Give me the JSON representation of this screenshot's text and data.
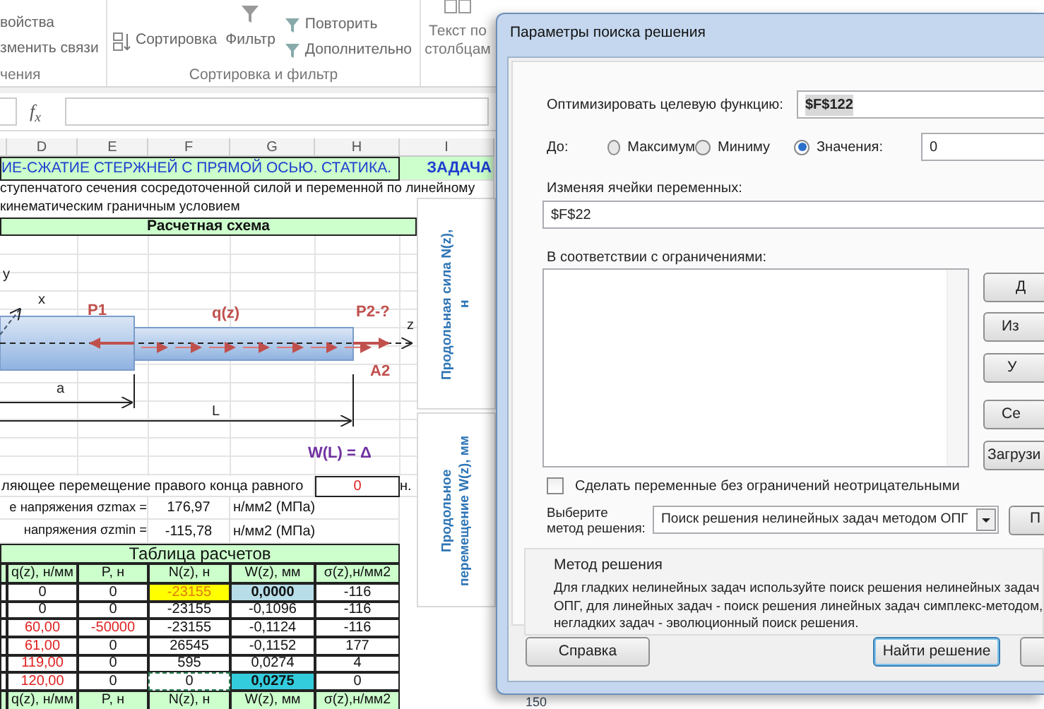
{
  "ribbon": {
    "connections": {
      "items": [
        "войства",
        "зменить связи"
      ],
      "label": "чения"
    },
    "sort_filter": {
      "sort": "Сортировка",
      "filter": "Фильтр",
      "items": [
        "Повторить",
        "Дополнительно"
      ],
      "label": "Сортировка и фильтр"
    },
    "text_to_columns": [
      "Текст по",
      "столбцам"
    ]
  },
  "formula_bar": {
    "fx": "f$_{x}$"
  },
  "columns": [
    "D",
    "E",
    "F",
    "G",
    "H",
    "I"
  ],
  "sheet": {
    "title": "ИЕ-СЖАТИЕ СТЕРЖНЕЙ С ПРЯМОЙ ОСЬЮ. СТАТИКА.",
    "task": "ЗАДАЧА",
    "description": [
      "ступенчатого сечения сосредоточенной силой и переменной по линейному",
      "кинематическим граничным условием"
    ],
    "scheme_title": "Расчетная схема",
    "scheme_labels": [
      {
        "text": "y",
        "kind": "axis"
      },
      {
        "text": "x",
        "kind": "axis"
      },
      {
        "text": "P1",
        "kind": "force"
      },
      {
        "text": "q(z)",
        "kind": "force"
      },
      {
        "text": "P2-?",
        "kind": "force"
      },
      {
        "text": "z",
        "kind": "axis"
      },
      {
        "text": "A2",
        "kind": "force"
      },
      {
        "text": "a",
        "kind": "dimension"
      },
      {
        "text": "L",
        "kind": "dimension"
      },
      {
        "text": "W(L) = Δ",
        "kind": "displacement"
      }
    ],
    "side_charts": [
      {
        "title": "Продольная сила N(z), н"
      },
      {
        "title": "Продольное перемещение W(z), мм"
      }
    ],
    "results": [
      {
        "kind": "target",
        "label": "ляющее перемещение правого конца равного",
        "value": "0",
        "unit": "н."
      },
      {
        "kind": "stress",
        "label": "е напряжения σzmax =",
        "value": "176,97",
        "unit": "н/мм2 (МПа)"
      },
      {
        "kind": "stress",
        "label": "напряжения σzmin =",
        "value": "-115,78",
        "unit": "н/мм2 (МПа)"
      }
    ],
    "table": {
      "title": "Таблица расчетов",
      "columns": [
        "q(z), н/мм",
        "P, н",
        "N(z), н",
        "W(z), мм",
        "σ(z),н/мм2"
      ],
      "rows": [
        [
          {
            "text": "0"
          },
          {
            "text": "0"
          },
          {
            "text": "-23155",
            "color": "#ffff00",
            "accent": true
          },
          {
            "text": "0,0000",
            "color": "#b7dde8",
            "bold": true
          },
          {
            "text": "-116"
          }
        ],
        [
          {
            "text": "0"
          },
          {
            "text": "0"
          },
          {
            "text": "-23155"
          },
          {
            "text": "-0,1096"
          },
          {
            "text": "-116"
          }
        ],
        [
          {
            "text": "60,00",
            "accent": true
          },
          {
            "text": "-50000",
            "accent": true
          },
          {
            "text": "-23155"
          },
          {
            "text": "-0,1124"
          },
          {
            "text": "-116"
          }
        ],
        [
          {
            "text": "61,00",
            "accent": true
          },
          {
            "text": "0"
          },
          {
            "text": "26545"
          },
          {
            "text": "-0,1152"
          },
          {
            "text": "177"
          }
        ],
        [
          {
            "text": "119,00",
            "accent": true
          },
          {
            "text": "0"
          },
          {
            "text": "595"
          },
          {
            "text": "0,0274"
          },
          {
            "text": "4"
          }
        ],
        [
          {
            "text": "120,00",
            "accent": true
          },
          {
            "text": "0"
          },
          {
            "text": "0",
            "marked": true
          },
          {
            "text": "0,0275",
            "color": "#33ccdd",
            "bold": true
          },
          {
            "text": "0"
          }
        ]
      ],
      "repeat_columns": [
        "q(z), н/мм",
        "P, н",
        "N(z), н",
        "W(z), мм",
        "σ(z),н/мм2"
      ]
    },
    "chart_tick": "150"
  },
  "dialog": {
    "title": "Параметры поиска решения",
    "objective": {
      "label": "Оптимизировать целевую функцию:",
      "value": "$F$122"
    },
    "to": {
      "label": "До:",
      "options": [
        {
          "label": "Максимум",
          "selected": false
        },
        {
          "label": "Миниму",
          "selected": false
        },
        {
          "label": "Значения:",
          "selected": true
        }
      ],
      "value": "0"
    },
    "variables": {
      "label": "Изменяя ячейки переменных:",
      "value": "$F$22"
    },
    "constraints": {
      "label": "В соответствии с ограничениями:",
      "buttons": [
        "Д",
        "Из",
        "У",
        "Се",
        "Загрузи"
      ]
    },
    "nonnegative": {
      "label": "Сделать переменные без ограничений неотрицательными",
      "checked": false
    },
    "method": {
      "label": [
        "Выберите",
        "метод решения:"
      ],
      "value": "Поиск решения нелинейных задач методом ОПГ",
      "button": "П"
    },
    "method_group": {
      "title": "Метод решения",
      "lines": [
        "Для гладких нелинейных задач используйте поиск решения нелинейных задач",
        "ОПГ, для линейных задач - поиск решения линейных задач симплекс-методом,",
        "негладких задач - эволюционный поиск решения."
      ]
    },
    "footer": {
      "help": "Справка",
      "solve": "Найти решение"
    }
  }
}
